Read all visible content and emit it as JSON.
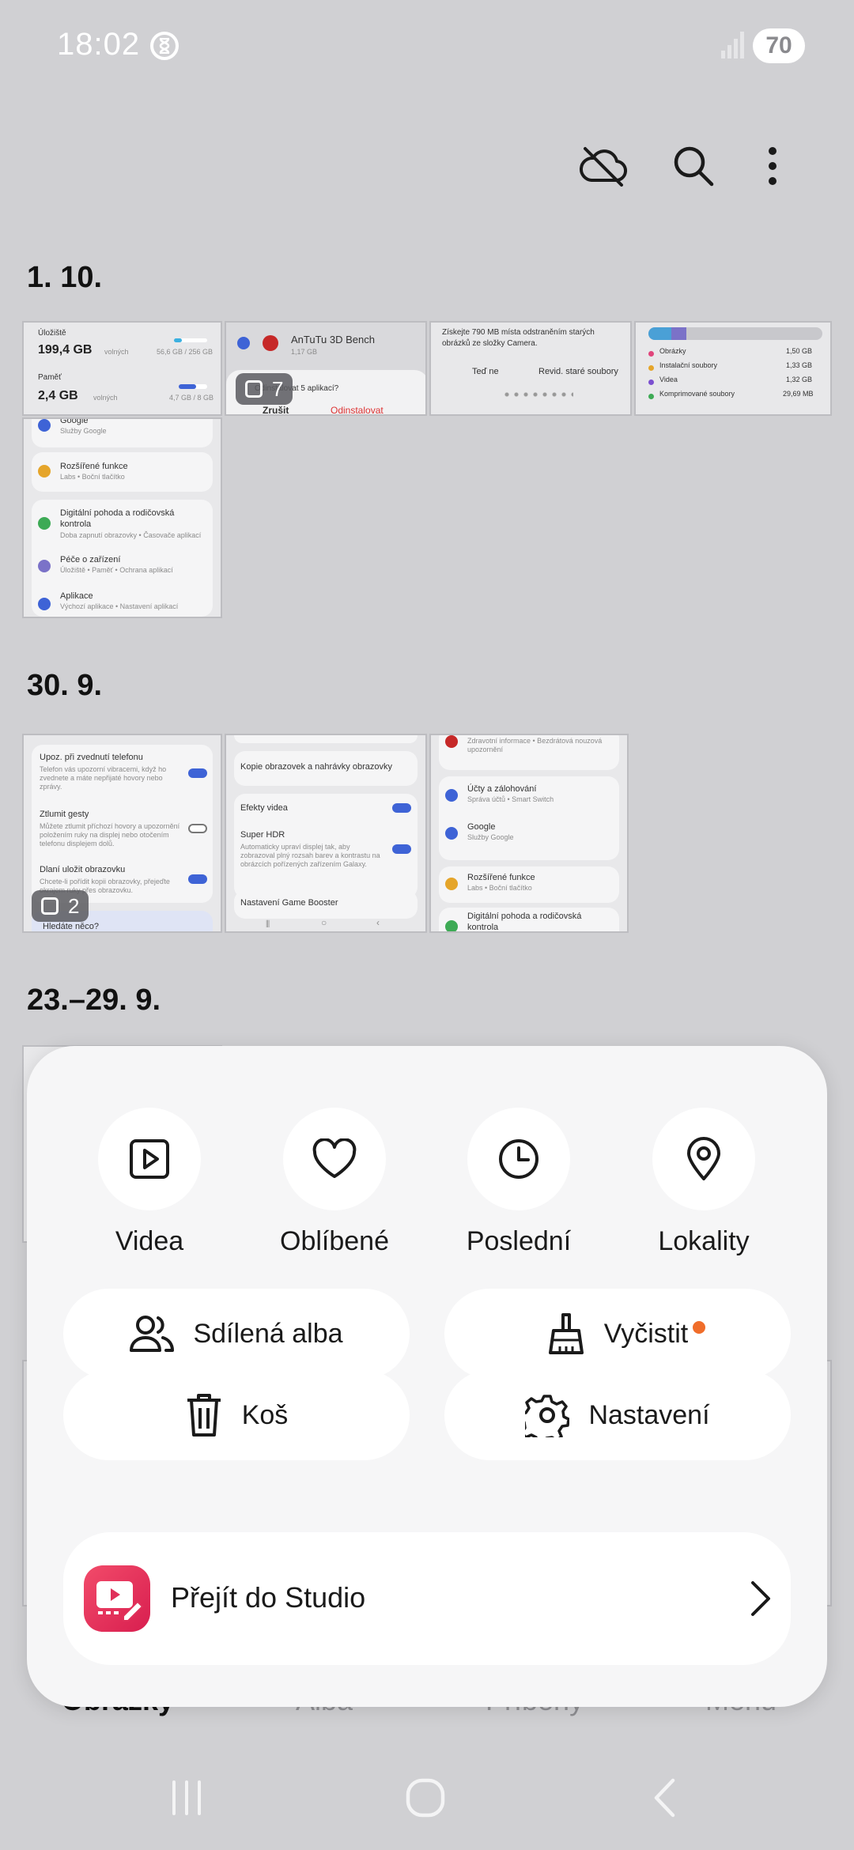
{
  "status_bar": {
    "time": "18:02",
    "battery": "70"
  },
  "toolbar": {
    "icons": [
      "cloud-off-icon",
      "search-icon",
      "more-vert-icon"
    ]
  },
  "groups": [
    {
      "date": "1. 10.",
      "count_badge": "7"
    },
    {
      "date": "30. 9.",
      "count_badge": "2"
    },
    {
      "date": "23.–29. 9."
    }
  ],
  "thumbs": {
    "storage": {
      "storage_label": "Úložiště",
      "storage_value": "199,4 GB",
      "storage_free": "volných",
      "storage_detail": "56,6 GB / 256 GB",
      "memory_label": "Paměť",
      "memory_value": "2,4 GB",
      "memory_free": "volných",
      "memory_detail": "4,7 GB / 8 GB"
    },
    "antutu": {
      "app_name": "AnTuTu 3D Bench",
      "app_size": "1,17 GB",
      "question": "Odinstalovat 5 aplikací?",
      "cancel": "Zrušit",
      "uninstall": "Odinstalovat"
    },
    "camera_tip": {
      "text": "Získejte 790 MB místa odstraněním starých obrázků ze složky Camera.",
      "btn_now": "Teď ne",
      "btn_review": "Revid. staré soubory"
    },
    "storage_breakdown": {
      "rows": [
        {
          "label": "Obrázky",
          "value": "1,50 GB",
          "color": "#e0457b"
        },
        {
          "label": "Instalační soubory",
          "value": "1,33 GB",
          "color": "#e5a52a"
        },
        {
          "label": "Videa",
          "value": "1,32 GB",
          "color": "#7b4fd0"
        },
        {
          "label": "Komprimované soubory",
          "value": "29,69 MB",
          "color": "#3daa55"
        }
      ]
    },
    "settings_list": {
      "items": [
        {
          "title": "Google",
          "sub": "Služby Google"
        },
        {
          "title": "Rozšířené funkce",
          "sub": "Labs • Boční tlačítko"
        },
        {
          "title": "Digitální pohoda a rodičovská kontrola",
          "sub": "Doba zapnutí obrazovky • Časovače aplikací"
        },
        {
          "title": "Péče o zařízení",
          "sub": "Úložiště • Paměť • Ochrana aplikací"
        },
        {
          "title": "Aplikace",
          "sub": "Výchozí aplikace • Nastavení aplikací"
        }
      ]
    },
    "call_settings": {
      "items": [
        {
          "title": "Upoz. při zvednutí telefonu",
          "sub": "Telefon vás upozorní vibracemi, když ho zvednete a máte nepřijaté hovory nebo zprávy."
        },
        {
          "title": "Ztlumit gesty",
          "sub": "Můžete ztlumit příchozí hovory a upozornění položením ruky na displej nebo otočením telefonu displejem dolů."
        },
        {
          "title": "Dlaní uložit obrazovku",
          "sub": "Chcete-li pořídit kopii obrazovky, přejeďte okrajem ruky přes obrazovku."
        }
      ],
      "search_hint": "Hledáte něco?"
    },
    "video_settings": {
      "items": [
        {
          "title": "Kopie obrazovek a nahrávky obrazovky",
          "sub": ""
        },
        {
          "title": "Efekty videa",
          "sub": ""
        },
        {
          "title": "Super HDR",
          "sub": "Automaticky upraví displej tak, aby zobrazoval plný rozsah barev a kontrastu na obrázcích pořízených zařízením Galaxy."
        },
        {
          "title": "Nastavení Game Booster",
          "sub": ""
        }
      ]
    },
    "settings_list2": {
      "items": [
        {
          "title": "Zdravotní informace • Bezdrátová nouzová upozornění",
          "sub": ""
        },
        {
          "title": "Účty a zálohování",
          "sub": "Správa účtů • Smart Switch"
        },
        {
          "title": "Google",
          "sub": "Služby Google"
        },
        {
          "title": "Rozšířené funkce",
          "sub": "Labs • Boční tlačítko"
        },
        {
          "title": "Digitální pohoda a rodičovská kontrola",
          "sub": ""
        }
      ]
    }
  },
  "bottom_nav": {
    "tabs": [
      "Obrázky",
      "Alba",
      "Příběhy",
      "Menu"
    ]
  },
  "sheet": {
    "quick": [
      {
        "label": "Videa",
        "icon": "play-square-icon"
      },
      {
        "label": "Oblíbené",
        "icon": "heart-icon"
      },
      {
        "label": "Poslední",
        "icon": "clock-icon"
      },
      {
        "label": "Lokality",
        "icon": "location-pin-icon"
      }
    ],
    "shared_albums": "Sdílená alba",
    "clean": "Vyčistit",
    "trash": "Koš",
    "settings": "Nastavení",
    "studio": "Přejít do Studio",
    "accent_dot_color": "#f06d2a"
  }
}
